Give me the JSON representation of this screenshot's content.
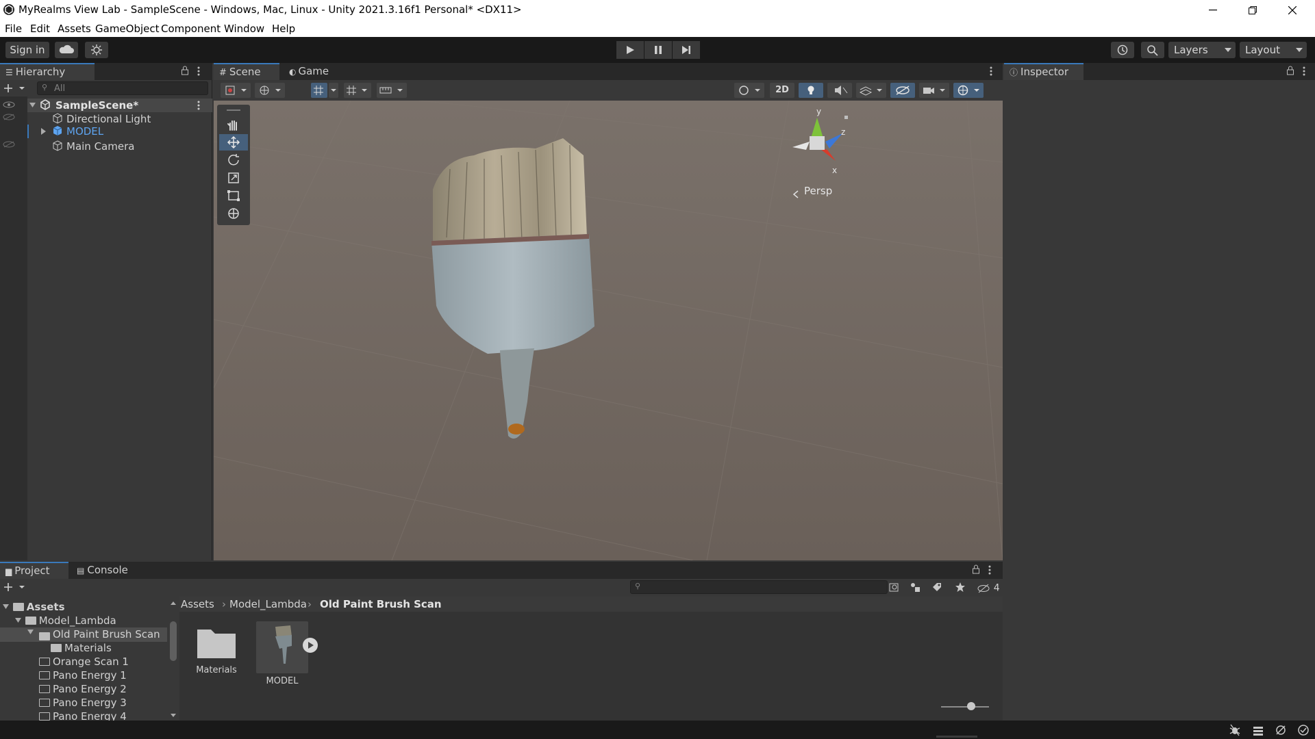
{
  "window": {
    "title": "MyRealms View Lab - SampleScene - Windows, Mac, Linux - Unity 2021.3.16f1 Personal* <DX11>"
  },
  "menu": [
    "File",
    "Edit",
    "Assets",
    "GameObject",
    "Component",
    "Window",
    "Help"
  ],
  "toolbar": {
    "sign_in": "Sign in",
    "layers": "Layers",
    "layout": "Layout"
  },
  "hierarchy": {
    "tab": "Hierarchy",
    "search_placeholder": "All",
    "scene": "SampleScene*",
    "items": [
      "Directional Light",
      "MODEL",
      "Main Camera"
    ]
  },
  "scene": {
    "tabs": [
      "Scene",
      "Game"
    ],
    "btn_2d": "2D",
    "gizmo": {
      "y": "y",
      "z": "z",
      "x": "x",
      "persp": "Persp"
    }
  },
  "inspector": {
    "tab": "Inspector"
  },
  "project": {
    "tabs": [
      "Project",
      "Console"
    ],
    "tree_root": "Assets",
    "tree": [
      "Model_Lambda",
      "Old Paint Brush Scan",
      "Materials",
      "Orange Scan 1",
      "Pano Energy 1",
      "Pano Energy 2",
      "Pano Energy 3",
      "Pano Energy 4"
    ],
    "breadcrumb": [
      "Assets",
      "Model_Lambda",
      "Old Paint Brush Scan"
    ],
    "hidden_count": "4",
    "assets": [
      "Materials",
      "MODEL"
    ]
  },
  "colors": {
    "accent": "#3a79bb",
    "selected_text": "#5ea4f0",
    "scene_bg": "#6e645c",
    "panel_bg": "#383838",
    "toolbar_bg": "#191919"
  }
}
